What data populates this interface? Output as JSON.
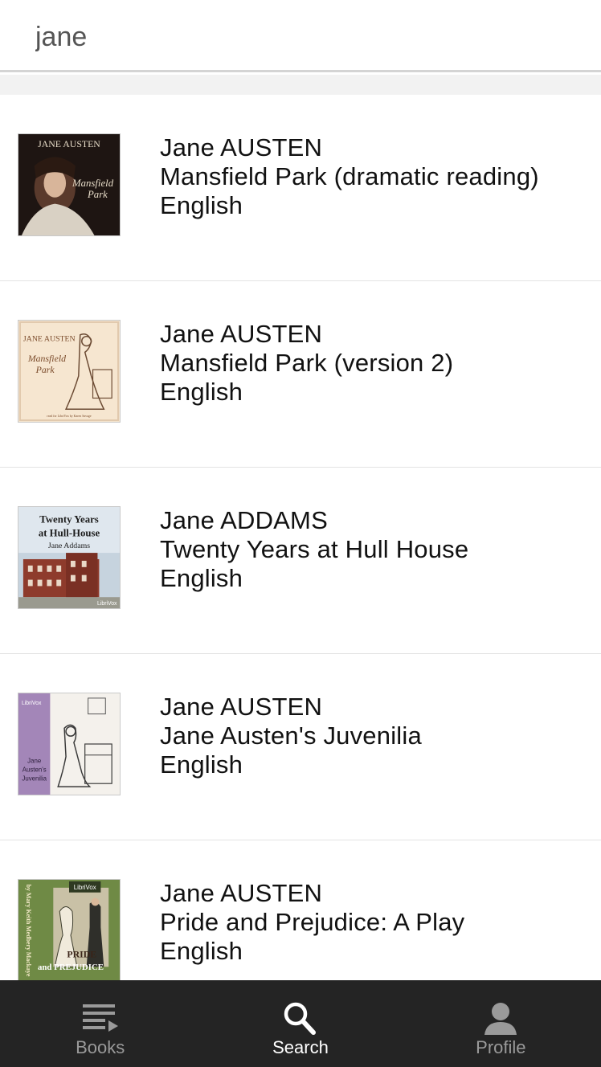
{
  "search": {
    "value": "jane"
  },
  "results": [
    {
      "author": "Jane AUSTEN",
      "title": "Mansfield Park (dramatic reading)",
      "language": "English",
      "cover": {
        "top_text": "JANE AUSTEN",
        "script_text": "Mansfield Park"
      }
    },
    {
      "author": "Jane AUSTEN",
      "title": "Mansfield Park (version 2)",
      "language": "English",
      "cover": {
        "top_text": "JANE AUSTEN",
        "script_text": "Mansfield Park"
      }
    },
    {
      "author": "Jane ADDAMS",
      "title": "Twenty Years at Hull House",
      "language": "English",
      "cover": {
        "line1": "Twenty Years",
        "line2": "at Hull-House",
        "line3": "Jane Addams",
        "brand": "LibriVox"
      }
    },
    {
      "author": "Jane AUSTEN",
      "title": "Jane Austen's Juvenilia",
      "language": "English",
      "cover": {
        "brand": "LibriVox",
        "line1": "Jane",
        "line2": "Austen's",
        "line3": "Juvenilia"
      }
    },
    {
      "author": "Jane AUSTEN",
      "title": "Pride and Prejudice: A Play",
      "language": "English",
      "cover": {
        "brand": "LibriVox",
        "side": "by Mary Keith Medbery Mackaye",
        "line1": "PRIDE",
        "line2": "and PREJUDICE"
      }
    }
  ],
  "tabs": [
    {
      "label": "Books",
      "icon": "list-icon",
      "active": false
    },
    {
      "label": "Search",
      "icon": "search-icon",
      "active": true
    },
    {
      "label": "Profile",
      "icon": "person-icon",
      "active": false
    }
  ],
  "colors": {
    "tabbar_bg": "#242424",
    "tab_active": "#ffffff",
    "tab_inactive": "#9a9a9a",
    "divider": "#e3e3e3"
  }
}
